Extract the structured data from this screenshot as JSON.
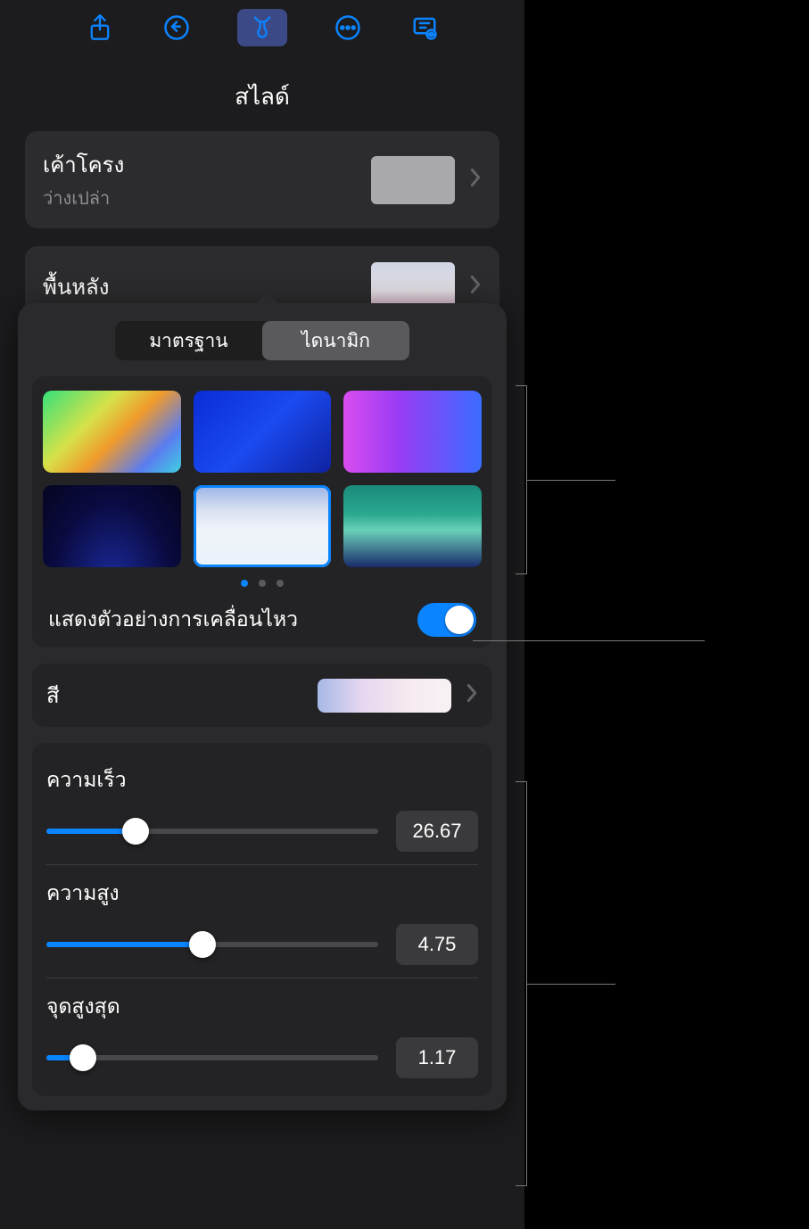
{
  "title": "สไลด์",
  "layout": {
    "label": "เค้าโครง",
    "sub": "ว่างเปล่า"
  },
  "background": {
    "label": "พื้นหลัง"
  },
  "segmented": {
    "standard": "มาตรฐาน",
    "dynamic": "ไดนามิก"
  },
  "motion": {
    "label": "แสดงตัวอย่างการเคลื่อนไหว",
    "on": true
  },
  "color": {
    "label": "สี"
  },
  "sliders": {
    "speed": {
      "label": "ความเร็ว",
      "value": "26.67",
      "pct": 27
    },
    "height": {
      "label": "ความสูง",
      "value": "4.75",
      "pct": 47
    },
    "peak": {
      "label": "จุดสูงสุด",
      "value": "1.17",
      "pct": 11
    }
  },
  "swatches": [
    {
      "css": "linear-gradient(135deg,#35e07a 0%,#d6e24a 35%,#f09a2b 55%,#5a7df0 80%,#3fd0e0 100%)"
    },
    {
      "css": "linear-gradient(135deg,#0a2cd6 0%,#1a4af0 50%,#0f22a0 100%)"
    },
    {
      "css": "linear-gradient(90deg,#d94cf0 0%,#9a3cf5 40%,#3a6cff 100%)"
    },
    {
      "css": "radial-gradient(ellipse at 50% 120%, #1a2a9a 0%, #0a0a40 60%, #050520 100%)"
    },
    {
      "css": "linear-gradient(180deg,#9ab4e6 0%,#d8e0f0 30%,#f0f4fa 55%,#eaf2fa 100%)",
      "selected": true
    },
    {
      "css": "linear-gradient(180deg,#1a8a7a 0%,#2aa890 35%,#6ad0b8 55%,#1a2a6a 100%)"
    }
  ]
}
